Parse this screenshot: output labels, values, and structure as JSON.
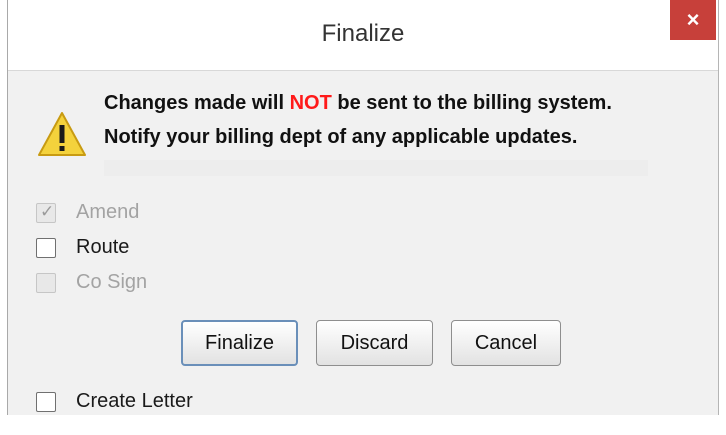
{
  "dialog": {
    "title": "Finalize",
    "close_label": "×"
  },
  "message": {
    "line1_before": "Changes made will ",
    "line1_highlight": "NOT",
    "line1_after": " be sent to the billing system.",
    "line2": "Notify your billing dept of any applicable updates.",
    "highlight_color": "#ff1a1a",
    "icon": "warning-icon"
  },
  "options": {
    "amend": {
      "label": "Amend",
      "checked": true,
      "enabled": false
    },
    "route": {
      "label": "Route",
      "checked": false,
      "enabled": true
    },
    "cosign": {
      "label": "Co Sign",
      "checked": false,
      "enabled": false
    },
    "create_letter": {
      "label": "Create Letter",
      "checked": false,
      "enabled": true
    }
  },
  "buttons": {
    "finalize": "Finalize",
    "discard": "Discard",
    "cancel": "Cancel"
  },
  "colors": {
    "close_button": "#c7403a",
    "primary_border": "#6a8fb9"
  }
}
